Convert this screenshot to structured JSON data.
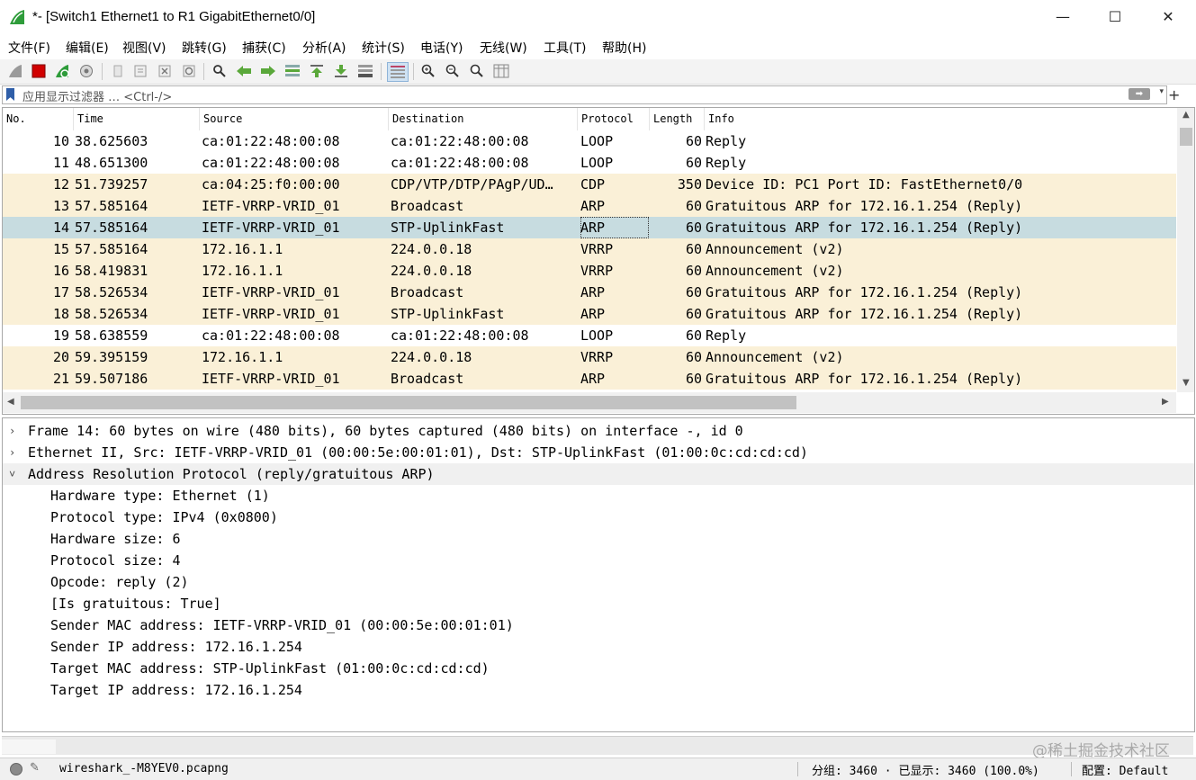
{
  "window": {
    "title": "*- [Switch1 Ethernet1 to R1 GigabitEthernet0/0]",
    "minimize": "—",
    "maximize": "☐",
    "close": "✕"
  },
  "menu": [
    "文件(F)",
    "编辑(E)",
    "视图(V)",
    "跳转(G)",
    "捕获(C)",
    "分析(A)",
    "统计(S)",
    "电话(Y)",
    "无线(W)",
    "工具(T)",
    "帮助(H)"
  ],
  "toolbar_icons": [
    "shark-fin-start-icon",
    "stop-icon",
    "restart-icon",
    "options-gear-icon",
    "open-file-icon",
    "save-file-icon",
    "close-file-icon",
    "reload-icon",
    "find-icon",
    "go-back-icon",
    "go-forward-icon",
    "go-to-packet-icon",
    "go-first-icon",
    "go-last-icon",
    "autoscroll-icon",
    "colorize-icon",
    "zoom-in-icon",
    "zoom-out-icon",
    "zoom-normal-icon",
    "resize-columns-icon"
  ],
  "filter": {
    "placeholder": "应用显示过滤器 … <Ctrl-/>",
    "apply": "➡",
    "dropdown": "▾",
    "add": "+"
  },
  "packet_list": {
    "columns": [
      "No.",
      "Time",
      "Source",
      "Destination",
      "Protocol",
      "Length",
      "Info"
    ],
    "rows": [
      {
        "no": "10",
        "time": "38.625603",
        "src": "ca:01:22:48:00:08",
        "dst": "ca:01:22:48:00:08",
        "proto": "LOOP",
        "len": "60",
        "info": "Reply",
        "color": "#ffffff"
      },
      {
        "no": "11",
        "time": "48.651300",
        "src": "ca:01:22:48:00:08",
        "dst": "ca:01:22:48:00:08",
        "proto": "LOOP",
        "len": "60",
        "info": "Reply",
        "color": "#ffffff"
      },
      {
        "no": "12",
        "time": "51.739257",
        "src": "ca:04:25:f0:00:00",
        "dst": "CDP/VTP/DTP/PAgP/UD…",
        "proto": "CDP",
        "len": "350",
        "info": "Device ID: PC1  Port ID: FastEthernet0/0",
        "color": "#faf0d7"
      },
      {
        "no": "13",
        "time": "57.585164",
        "src": "IETF-VRRP-VRID_01",
        "dst": "Broadcast",
        "proto": "ARP",
        "len": "60",
        "info": "Gratuitous ARP for 172.16.1.254 (Reply)",
        "color": "#faf0d7"
      },
      {
        "no": "14",
        "time": "57.585164",
        "src": "IETF-VRRP-VRID_01",
        "dst": "STP-UplinkFast",
        "proto": "ARP",
        "len": "60",
        "info": "Gratuitous ARP for 172.16.1.254 (Reply)",
        "color": "#c7dce0",
        "selected": true
      },
      {
        "no": "15",
        "time": "57.585164",
        "src": "172.16.1.1",
        "dst": "224.0.0.18",
        "proto": "VRRP",
        "len": "60",
        "info": "Announcement (v2)",
        "color": "#faf0d7"
      },
      {
        "no": "16",
        "time": "58.419831",
        "src": "172.16.1.1",
        "dst": "224.0.0.18",
        "proto": "VRRP",
        "len": "60",
        "info": "Announcement (v2)",
        "color": "#faf0d7"
      },
      {
        "no": "17",
        "time": "58.526534",
        "src": "IETF-VRRP-VRID_01",
        "dst": "Broadcast",
        "proto": "ARP",
        "len": "60",
        "info": "Gratuitous ARP for 172.16.1.254 (Reply)",
        "color": "#faf0d7"
      },
      {
        "no": "18",
        "time": "58.526534",
        "src": "IETF-VRRP-VRID_01",
        "dst": "STP-UplinkFast",
        "proto": "ARP",
        "len": "60",
        "info": "Gratuitous ARP for 172.16.1.254 (Reply)",
        "color": "#faf0d7"
      },
      {
        "no": "19",
        "time": "58.638559",
        "src": "ca:01:22:48:00:08",
        "dst": "ca:01:22:48:00:08",
        "proto": "LOOP",
        "len": "60",
        "info": "Reply",
        "color": "#ffffff"
      },
      {
        "no": "20",
        "time": "59.395159",
        "src": "172.16.1.1",
        "dst": "224.0.0.18",
        "proto": "VRRP",
        "len": "60",
        "info": "Announcement (v2)",
        "color": "#faf0d7"
      },
      {
        "no": "21",
        "time": "59.507186",
        "src": "IETF-VRRP-VRID_01",
        "dst": "Broadcast",
        "proto": "ARP",
        "len": "60",
        "info": "Gratuitous ARP for 172.16.1.254 (Reply)",
        "color": "#faf0d7"
      }
    ]
  },
  "details": [
    {
      "text": "Frame 14: 60 bytes on wire (480 bits), 60 bytes captured (480 bits) on interface -, id 0",
      "twisty": "›",
      "level": 0
    },
    {
      "text": "Ethernet II, Src: IETF-VRRP-VRID_01 (00:00:5e:00:01:01), Dst: STP-UplinkFast (01:00:0c:cd:cd:cd)",
      "twisty": "›",
      "level": 0
    },
    {
      "text": "Address Resolution Protocol (reply/gratuitous ARP)",
      "twisty": "˅",
      "level": 0,
      "highlight": true
    },
    {
      "text": "Hardware type: Ethernet (1)",
      "level": 1
    },
    {
      "text": "Protocol type: IPv4 (0x0800)",
      "level": 1
    },
    {
      "text": "Hardware size: 6",
      "level": 1
    },
    {
      "text": "Protocol size: 4",
      "level": 1
    },
    {
      "text": "Opcode: reply (2)",
      "level": 1
    },
    {
      "text": "[Is gratuitous: True]",
      "level": 1
    },
    {
      "text": "Sender MAC address: IETF-VRRP-VRID_01 (00:00:5e:00:01:01)",
      "level": 1
    },
    {
      "text": "Sender IP address: 172.16.1.254",
      "level": 1
    },
    {
      "text": "Target MAC address: STP-UplinkFast (01:00:0c:cd:cd:cd)",
      "level": 1
    },
    {
      "text": "Target IP address: 172.16.1.254",
      "level": 1
    }
  ],
  "status": {
    "file": "wireshark_-M8YEV0.pcapng",
    "stats": "分组: 3460 · 已显示: 3460 (100.0%)",
    "profile": "配置: Default"
  },
  "watermark": "@稀土掘金技术社区"
}
